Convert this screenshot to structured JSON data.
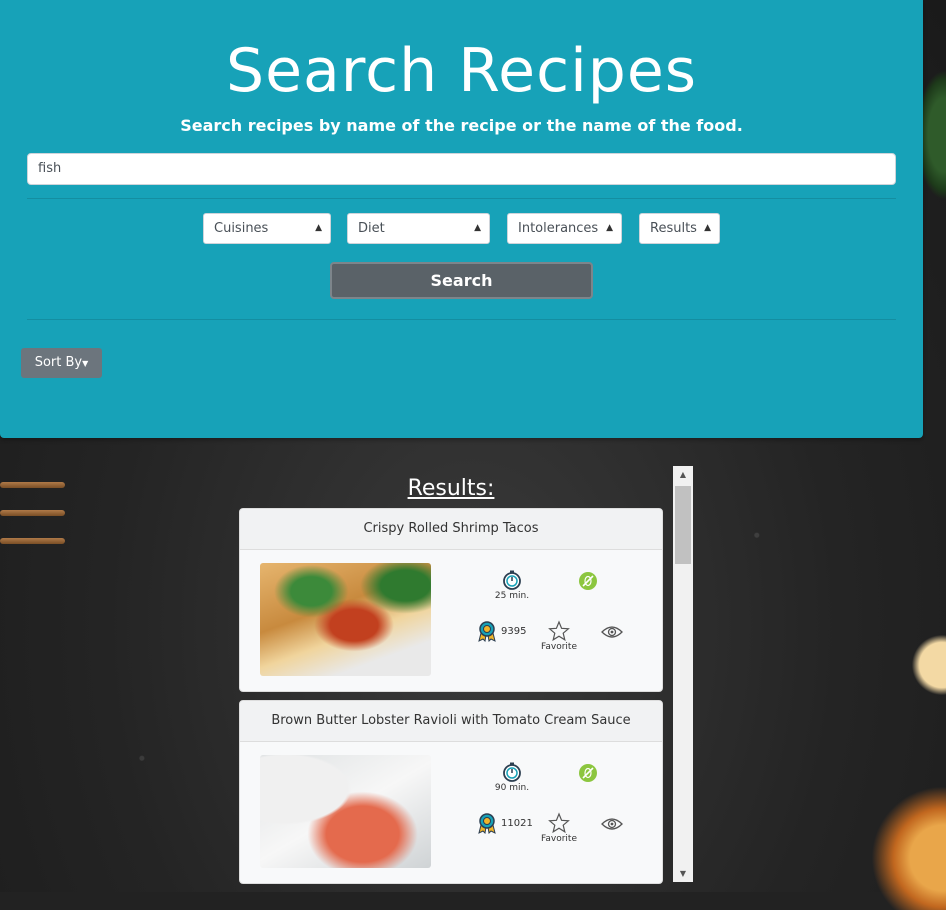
{
  "header": {
    "title": "Search Recipes",
    "subtitle": "Search recipes by name of the recipe or the name of the food."
  },
  "search": {
    "value": "fish",
    "button_label": "Search"
  },
  "filters": {
    "cuisines": "Cuisines",
    "diet": "Diet",
    "intolerances": "Intolerances",
    "results": "Results"
  },
  "sort": {
    "label": "Sort By"
  },
  "results": {
    "title": "Results:",
    "items": [
      {
        "name": "Crispy Rolled Shrimp Tacos",
        "time": "25 min.",
        "score": "9395",
        "favorite_label": "Favorite"
      },
      {
        "name": "Brown Butter Lobster Ravioli with Tomato Cream Sauce",
        "time": "90 min.",
        "score": "11021",
        "favorite_label": "Favorite"
      }
    ]
  },
  "colors": {
    "hero": "#17a2b8",
    "search_button": "#5a6268",
    "sort_button": "#6c757d",
    "diet_badge": "#8cc63f"
  }
}
